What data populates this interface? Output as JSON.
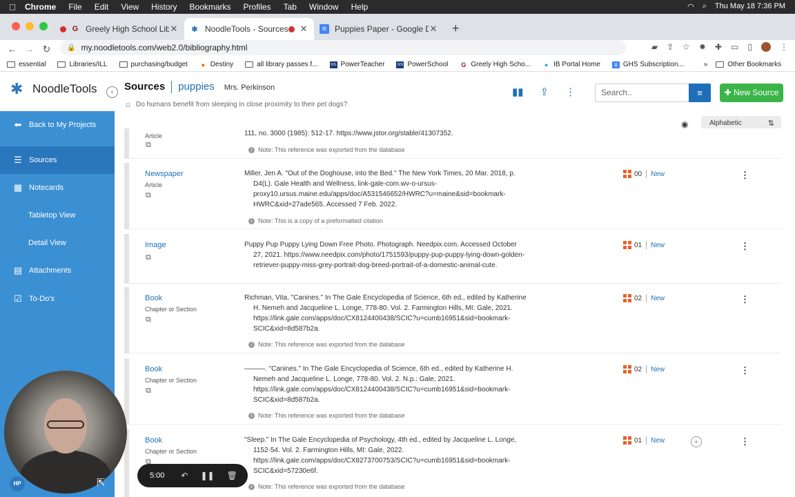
{
  "menubar": {
    "app": "Chrome",
    "items": [
      "File",
      "Edit",
      "View",
      "History",
      "Bookmarks",
      "Profiles",
      "Tab",
      "Window",
      "Help"
    ],
    "datetime": "Thu May 18  7:36 PM"
  },
  "tabs": [
    {
      "title": "Greely High School Library",
      "active": false
    },
    {
      "title": "NoodleTools - Sources",
      "active": true
    },
    {
      "title": "Puppies Paper - Google Docs",
      "active": false
    }
  ],
  "address": {
    "url": "my.noodletools.com/web2.0/bibliography.html"
  },
  "bookmarks": {
    "items": [
      "essential",
      "Libraries/ILL",
      "purchasing/budget",
      "Destiny",
      "all library passes f...",
      "PowerTeacher",
      "PowerSchool",
      "Greely High Scho...",
      "IB Portal Home",
      "GHS Subscription..."
    ],
    "overflow": "»",
    "other": "Other Bookmarks"
  },
  "header": {
    "logo": "NoodleTools",
    "section": "Sources",
    "project": "puppies",
    "teacher": "Mrs. Perkinson",
    "question": "Do humans benefit from sleeping in close proximity to their pet dogs?",
    "search_placeholder": "Search..",
    "new_source": "New Source"
  },
  "sidebar": {
    "back": "Back to My Projects",
    "items": [
      {
        "label": "Sources"
      },
      {
        "label": "Notecards"
      },
      {
        "label": "Tabletop View"
      },
      {
        "label": "Detail View"
      },
      {
        "label": "Attachments"
      },
      {
        "label": "To-Do's"
      }
    ]
  },
  "sort": {
    "label": "Alphabetic"
  },
  "entries": [
    {
      "type": "",
      "subtype": "Article",
      "cite": [
        "111, no. 3000 (1985): 512-17. https://www.jstor.org/stable/41307352."
      ],
      "note": "Note: This reference was exported from the database"
    },
    {
      "type": "Newspaper",
      "subtype": "Article",
      "cite": [
        "Miller, Jen A. \"Out of the Doghouse, into the Bed.\" The New York Times, 20 Mar. 2018, p. D4(L). Gale Health and Wellness, link-gale-com.wv-o-ursus-proxy10.ursus.maine.edu/apps/doc/A531546652/HWRC?u=maine&sid=bookmark-HWRC&xid=27ade565. Accessed 7 Feb. 2022."
      ],
      "note": "Note: This is a copy of a preformatted citation",
      "count": "00",
      "status": "New"
    },
    {
      "type": "Image",
      "subtype": "",
      "cite": [
        "Puppy Pup Puppy Lying Down Free Photo. Photograph. Needpix.com. Accessed October 27, 2021. https://www.needpix.com/photo/1751593/puppy-pup-puppy-lying-down-golden-retriever-puppy-miss-grey-portrait-dog-breed-portrait-of-a-domestic-animal-cute."
      ],
      "note": "",
      "count": "01",
      "status": "New"
    },
    {
      "type": "Book",
      "subtype": "Chapter or Section",
      "cite": [
        "Richman, Vita. \"Canines.\" In The Gale Encyclopedia of Science, 6th ed., edited by Katherine H. Nemeh and Jacqueline L. Longe, 778-80. Vol. 2. Farmington Hills, MI: Gale, 2021. https://link.gale.com/apps/doc/CX8124400438/SCIC?u=cumb16951&sid=bookmark-SCIC&xid=8d587b2a."
      ],
      "note": "Note: This reference was exported from the database",
      "count": "02",
      "status": "New"
    },
    {
      "type": "Book",
      "subtype": "Chapter or Section",
      "cite": [
        "———. \"Canines.\" In The Gale Encyclopedia of Science, 6th ed., edited by Katherine H. Nemeh and Jacqueline L. Longe, 778-80. Vol. 2. N.p.: Gale, 2021. https://link.gale.com/apps/doc/CX8124400438/SCIC?u=cumb16951&sid=bookmark-SCIC&xid=8d587b2a."
      ],
      "note": "Note: This reference was exported from the database",
      "count": "02",
      "status": "New"
    },
    {
      "type": "Book",
      "subtype": "Chapter or Section",
      "cite": [
        "\"Sleep.\" In The Gale Encyclopedia of Psychology, 4th ed., edited by Jacqueline L. Longe, 1152-54. Vol. 2. Farmington Hills, MI: Gale, 2022. https://link.gale.com/apps/doc/CX8273700753/SCIC?u=cumb16951&sid=bookmark-SCIC&xid=57230e6f."
      ],
      "note": "Note: This reference was exported from the database",
      "count": "01",
      "status": "New"
    }
  ],
  "recorder": {
    "time": "5:00"
  },
  "webcam_badge": "HP",
  "colors": {
    "sidebar": "#3b8fd3",
    "accent": "#1f6fb8",
    "new_source": "#3bb54a",
    "count_icon": "#e4632a"
  }
}
